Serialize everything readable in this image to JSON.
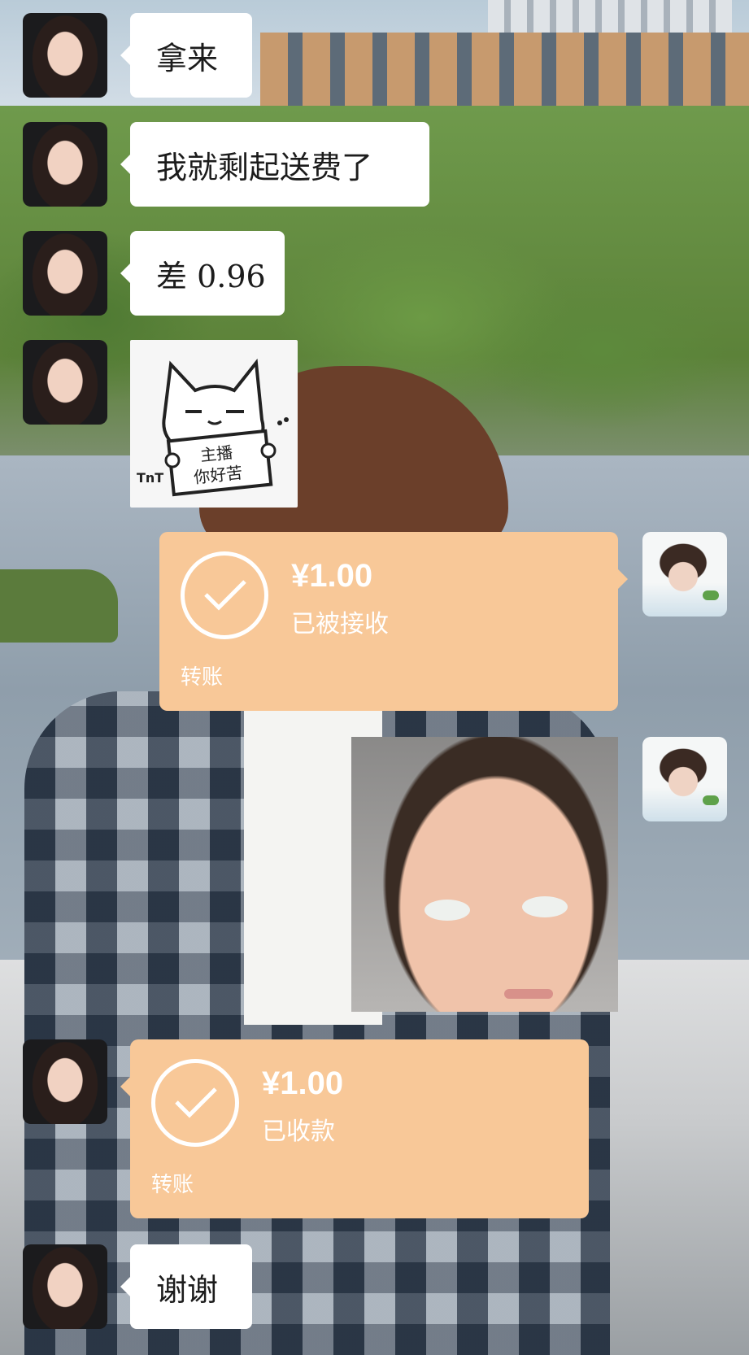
{
  "messages": {
    "m1": {
      "text": "拿来"
    },
    "m2": {
      "text": "我就剩起送费了"
    },
    "m3": {
      "text": "差 0.96"
    },
    "m4": {
      "sticker_text_line1": "主播",
      "sticker_text_line2": "你好苦",
      "sticker_face": "TnT"
    },
    "m5": {
      "amount": "¥1.00",
      "status": "已被接收",
      "kind": "转账"
    },
    "m7": {
      "amount": "¥1.00",
      "status": "已收款",
      "kind": "转账"
    },
    "m8": {
      "text": "谢谢"
    }
  },
  "icons": {
    "transfer_check": "check-circle-icon"
  },
  "colors": {
    "bubble_white": "#ffffff",
    "transfer_orange": "#f8c898"
  }
}
